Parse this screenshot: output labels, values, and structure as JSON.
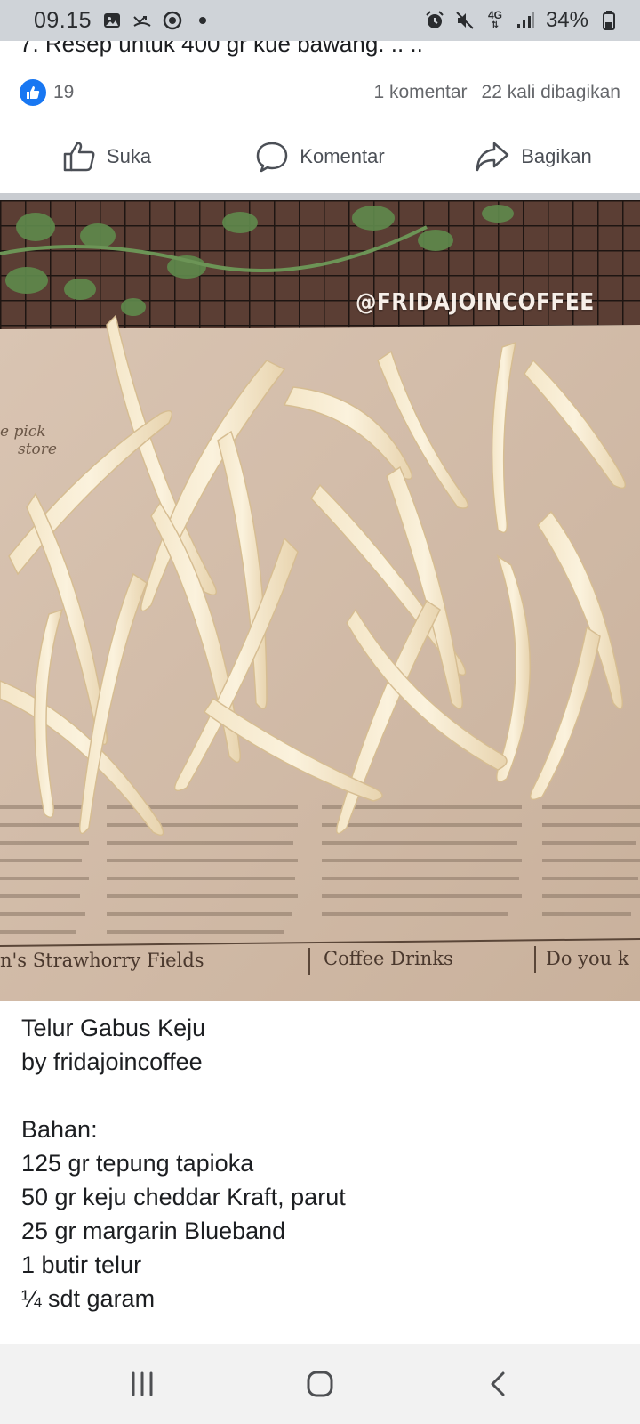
{
  "status_bar": {
    "time": "09.15",
    "left_icons": [
      "gallery-icon",
      "missed-call-icon",
      "location-icon",
      "dot-icon"
    ],
    "network": "4G",
    "battery": "34%"
  },
  "post": {
    "truncated_text": "7. Resep untuk 400 gr kue bawang. .. ..",
    "likes_count": "19",
    "comments": "1 komentar",
    "shares": "22 kali dibagikan",
    "actions": {
      "like": "Suka",
      "comment": "Komentar",
      "share": "Bagikan"
    }
  },
  "photo": {
    "watermark": "@FRIDAJOINCOFFEE",
    "newspaper_footer": [
      "n's Strawhorry Fields",
      "Coffee Drinks",
      "Do you k"
    ],
    "newspaper_heading": [
      "e pick",
      "store"
    ]
  },
  "caption": {
    "lines": [
      "Telur Gabus Keju",
      "by fridajoincoffee",
      "",
      "Bahan:",
      "125 gr tepung tapioka",
      "50 gr keju cheddar Kraft, parut",
      "25 gr margarin Blueband",
      "1 butir telur",
      "¼ sdt garam"
    ]
  },
  "colors": {
    "facebook_blue": "#1877f2",
    "status_bar_bg": "#cfd3d8",
    "nav_bar_bg": "#f2f2f2"
  }
}
